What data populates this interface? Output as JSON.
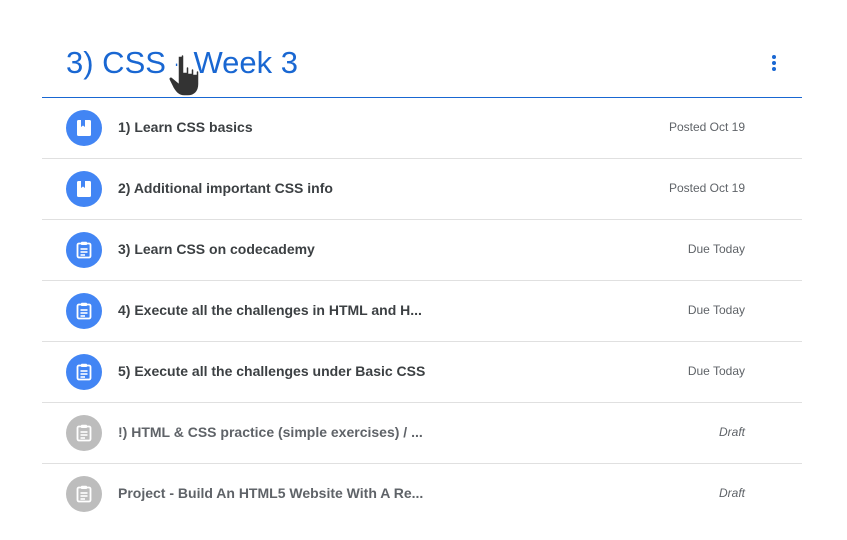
{
  "topic": {
    "title": "3) CSS - Week 3",
    "more_icon": "more-vert-icon"
  },
  "items": [
    {
      "title": "1) Learn CSS basics",
      "status": "Posted Oct 19",
      "icon": "material-icon",
      "draft": false
    },
    {
      "title": "2) Additional important CSS info",
      "status": "Posted Oct 19",
      "icon": "material-icon",
      "draft": false
    },
    {
      "title": "3) Learn CSS on codecademy",
      "status": "Due Today",
      "icon": "assignment-icon",
      "draft": false
    },
    {
      "title": "4) Execute all the challenges in HTML and H...",
      "status": "Due Today",
      "icon": "assignment-icon",
      "draft": false
    },
    {
      "title": "5) Execute all the challenges under Basic CSS",
      "status": "Due Today",
      "icon": "assignment-icon",
      "draft": false
    },
    {
      "title": "!) HTML & CSS practice (simple exercises) / ...",
      "status": "Draft",
      "icon": "assignment-icon",
      "draft": true
    },
    {
      "title": "Project - Build An HTML5 Website With A Re...",
      "status": "Draft",
      "icon": "assignment-icon",
      "draft": true
    }
  ],
  "colors": {
    "accent": "#1967d2",
    "icon_active": "#4285f4",
    "icon_draft": "#bdbdbd",
    "divider": "#e0e0e0"
  },
  "cursor": "hand-pointer-cursor"
}
